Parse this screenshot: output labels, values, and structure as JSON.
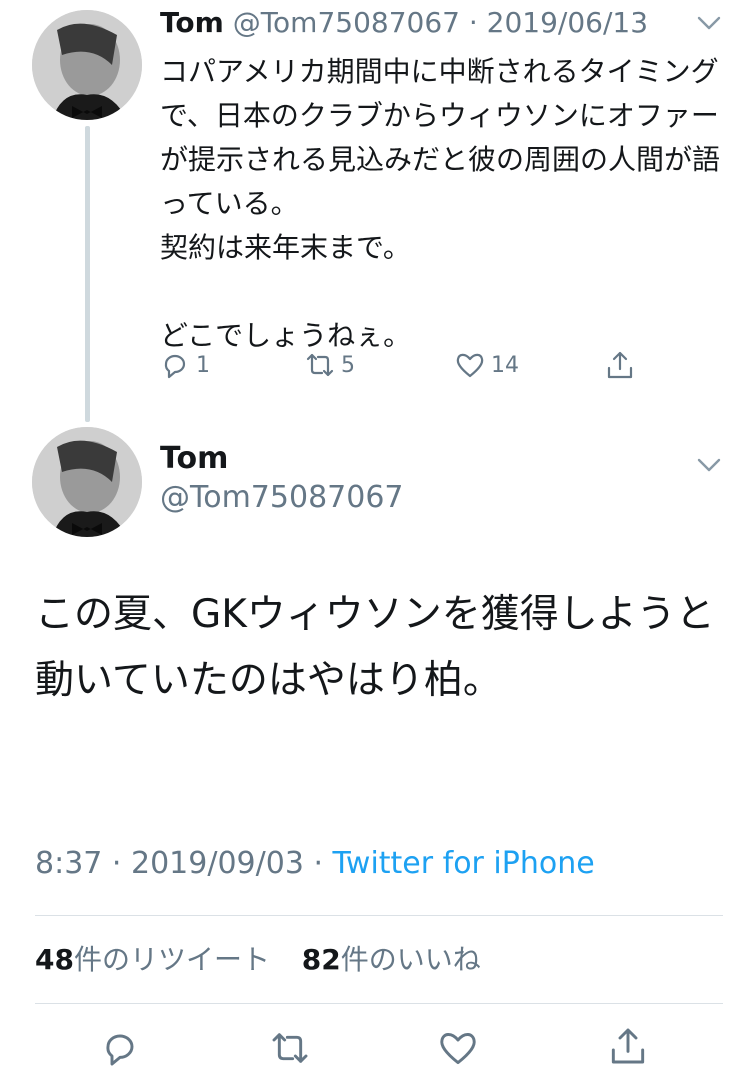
{
  "tweet1": {
    "name": "Tom",
    "handle_date": "@Tom75087067 · 2019/06/13",
    "text": "コパアメリカ期間中に中断されるタイミングで、日本のクラブからウィウソンにオファーが提示される見込みだと彼の周囲の人間が語っている。\n契約は来年末まで。\n\nどこでしょうねぇ。",
    "reply_count": "1",
    "retweet_count": "5",
    "like_count": "14"
  },
  "tweet2": {
    "name": "Tom",
    "handle": "@Tom75087067",
    "text": "この夏、GKウィウソンを獲得しようと動いていたのはやはり柏。",
    "time": "8:37",
    "date": "2019/09/03",
    "source": "Twitter for iPhone",
    "retweets_num": "48",
    "retweets_label": "件のリツイート",
    "likes_num": "82",
    "likes_label": "件のいいね"
  },
  "icons": [
    "reply-icon",
    "retweet-icon",
    "like-icon",
    "share-icon",
    "chevron-down-icon"
  ],
  "colors": {
    "accent": "#1da1f2",
    "muted": "#657786",
    "text": "#14171a",
    "divider": "#dbe1e6"
  }
}
